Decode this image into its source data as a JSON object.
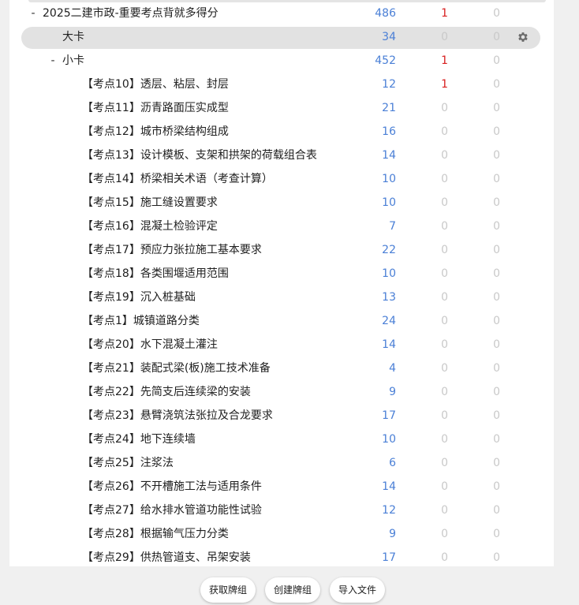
{
  "rows": [
    {
      "toggle": "-",
      "name": "2025二建市政-重要考点背就多得分",
      "new": "486",
      "learn": "1",
      "due": "0"
    },
    {
      "toggle": "",
      "name": "大卡",
      "new": "34",
      "learn": "0",
      "due": "0"
    },
    {
      "toggle": "-",
      "name": "小卡",
      "new": "452",
      "learn": "1",
      "due": "0"
    },
    {
      "toggle": "",
      "name": "【考点10】透层、粘层、封层",
      "new": "12",
      "learn": "1",
      "due": "0"
    },
    {
      "toggle": "",
      "name": "【考点11】沥青路面压实成型",
      "new": "21",
      "learn": "0",
      "due": "0"
    },
    {
      "toggle": "",
      "name": "【考点12】城市桥梁结构组成",
      "new": "16",
      "learn": "0",
      "due": "0"
    },
    {
      "toggle": "",
      "name": "【考点13】设计模板、支架和拱架的荷载组合表",
      "new": "14",
      "learn": "0",
      "due": "0"
    },
    {
      "toggle": "",
      "name": "【考点14】桥梁相关术语（考查计算）",
      "new": "10",
      "learn": "0",
      "due": "0"
    },
    {
      "toggle": "",
      "name": "【考点15】施工缝设置要求",
      "new": "10",
      "learn": "0",
      "due": "0"
    },
    {
      "toggle": "",
      "name": "【考点16】混凝土检验评定",
      "new": "7",
      "learn": "0",
      "due": "0"
    },
    {
      "toggle": "",
      "name": "【考点17】预应力张拉施工基本要求",
      "new": "22",
      "learn": "0",
      "due": "0"
    },
    {
      "toggle": "",
      "name": "【考点18】各类围堰适用范围",
      "new": "10",
      "learn": "0",
      "due": "0"
    },
    {
      "toggle": "",
      "name": "【考点19】沉入桩基础",
      "new": "13",
      "learn": "0",
      "due": "0"
    },
    {
      "toggle": "",
      "name": "【考点1】城镇道路分类",
      "new": "24",
      "learn": "0",
      "due": "0"
    },
    {
      "toggle": "",
      "name": "【考点20】水下混凝土灌注",
      "new": "14",
      "learn": "0",
      "due": "0"
    },
    {
      "toggle": "",
      "name": "【考点21】装配式梁(板)施工技术准备",
      "new": "4",
      "learn": "0",
      "due": "0"
    },
    {
      "toggle": "",
      "name": "【考点22】先简支后连续梁的安装",
      "new": "9",
      "learn": "0",
      "due": "0"
    },
    {
      "toggle": "",
      "name": "【考点23】悬臂浇筑法张拉及合龙要求",
      "new": "17",
      "learn": "0",
      "due": "0"
    },
    {
      "toggle": "",
      "name": "【考点24】地下连续墙",
      "new": "10",
      "learn": "0",
      "due": "0"
    },
    {
      "toggle": "",
      "name": "【考点25】注浆法",
      "new": "6",
      "learn": "0",
      "due": "0"
    },
    {
      "toggle": "",
      "name": "【考点26】不开槽施工法与适用条件",
      "new": "14",
      "learn": "0",
      "due": "0"
    },
    {
      "toggle": "",
      "name": "【考点27】给水排水管道功能性试验",
      "new": "12",
      "learn": "0",
      "due": "0"
    },
    {
      "toggle": "",
      "name": "【考点28】根据输气压力分类",
      "new": "9",
      "learn": "0",
      "due": "0"
    },
    {
      "toggle": "",
      "name": "【考点29】供热管道支、吊架安装",
      "new": "17",
      "learn": "0",
      "due": "0"
    }
  ],
  "footer": {
    "get_shared_label": "获取牌组",
    "create_deck_label": "创建牌组",
    "import_file_label": "导入文件"
  },
  "icons": {
    "options": "gear-icon"
  },
  "colors": {
    "new_count": "#4a7fd6",
    "learn_count_active": "#d81f1f",
    "zero_count": "#c9c9c9",
    "selected_row": "#e2e2e2"
  }
}
